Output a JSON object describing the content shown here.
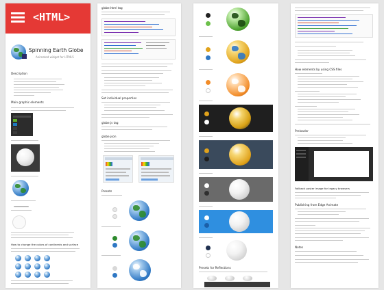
{
  "page1": {
    "badge_text": "<HTML>",
    "title": "Spinning Earth Globe",
    "subtitle": "Animated widget for HTML5",
    "desc_heading": "Description",
    "section1_heading": "Main graphic elements",
    "section2_heading": "How to change the colors of continents and surface"
  },
  "page2": {
    "heading1": "globe.html tag",
    "heading2": "Set individual properties",
    "heading3": "globe.js tag",
    "heading4": "globe.json",
    "heading5": "Presets"
  },
  "page3": {
    "heading_bottom": "Presets for Reflections"
  },
  "page4": {
    "heading1": "How elements by using CSS files",
    "heading2": "Preloader",
    "heading3": "Fallback poster image for legacy browsers",
    "heading4": "Publishing from Edge Animate",
    "heading5": "Notes"
  },
  "colors": {
    "badge_bg": "#e53935",
    "dark_panel": "#2c2c2c",
    "mid_panel": "#3a4a5c",
    "blue_panel": "#2f8fe0",
    "gray_panel": "#6a6a6a"
  },
  "icons": [
    "hamburger-icon",
    "globe-icon",
    "edge-animate-icon"
  ]
}
